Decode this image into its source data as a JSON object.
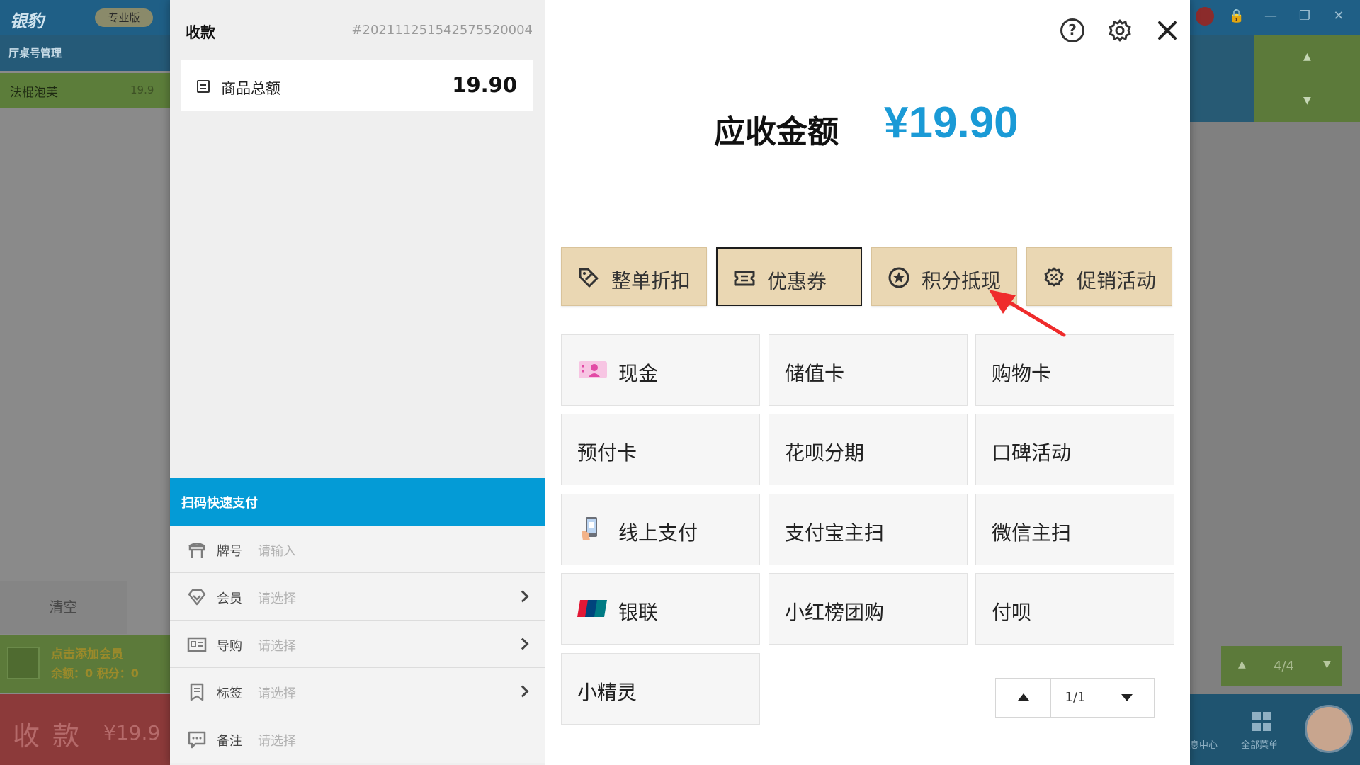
{
  "background": {
    "logo": "银豹",
    "edition": "专业版",
    "sub_nav": "厅桌号管理",
    "order_item": {
      "name": "法棍泡芙",
      "price": "19.9"
    },
    "clear_button": "清空",
    "member": {
      "add_text": "点击添加会员",
      "balance_text": "余额：0  积分：0"
    },
    "pay_button": {
      "label": "收款",
      "amount": "¥19.9"
    },
    "pager_text": "4/4",
    "bottom_nav": {
      "message": "息中心",
      "all_menu": "全部菜单"
    }
  },
  "dialog": {
    "title": "收款",
    "order_no": "#20211125154257552000​4",
    "goods_total": {
      "label": "商品总额",
      "value": "19.90"
    },
    "scan_pay": "扫码快速支付",
    "rows": [
      {
        "label": "牌号",
        "value": "请输入",
        "has_chevron": false
      },
      {
        "label": "会员",
        "value": "请选择",
        "has_chevron": true
      },
      {
        "label": "导购",
        "value": "请选择",
        "has_chevron": true
      },
      {
        "label": "标签",
        "value": "请选择",
        "has_chevron": true
      },
      {
        "label": "备注",
        "value": "请选择",
        "has_chevron": false
      }
    ],
    "amount_due": {
      "label": "应收金额",
      "value": "¥19.90"
    },
    "promotions": [
      {
        "label": "整单折扣",
        "icon": "tag-discount-icon"
      },
      {
        "label": "优惠券",
        "icon": "coupon-icon",
        "active": true
      },
      {
        "label": "积分抵现",
        "icon": "points-star-icon"
      },
      {
        "label": "促销活动",
        "icon": "promotion-gear-icon"
      }
    ],
    "payment_methods": [
      {
        "label": "现金",
        "icon": "cash-icon"
      },
      {
        "label": "储值卡"
      },
      {
        "label": "购物卡"
      },
      {
        "label": "预付卡"
      },
      {
        "label": "花呗分期"
      },
      {
        "label": "口碑活动"
      },
      {
        "label": "线上支付",
        "icon": "mobile-pay-icon"
      },
      {
        "label": "支付宝主扫"
      },
      {
        "label": "微信主扫"
      },
      {
        "label": "银联",
        "icon": "unionpay-icon"
      },
      {
        "label": "小红榜团购"
      },
      {
        "label": "付呗"
      },
      {
        "label": "小精灵"
      }
    ],
    "pager": {
      "text": "1/1"
    },
    "colors": {
      "accent": "#049bd6",
      "amount": "#1a9ad6",
      "promo_bg": "#ead7b3",
      "arrow": "#ef2b2b"
    }
  }
}
